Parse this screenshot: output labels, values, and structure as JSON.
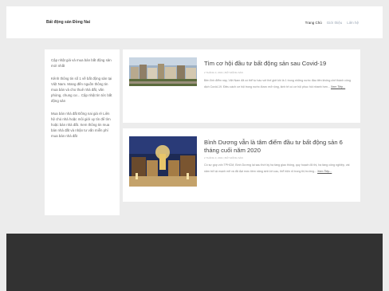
{
  "header": {
    "site_title": "Bất động sản Đồng Nai",
    "nav": [
      "Trang Chủ",
      "Giới thiệu",
      "Liên hệ"
    ]
  },
  "sidebar": {
    "paragraphs": [
      "Cập nhật giá và mua bán bất động sản mới nhất",
      "Kênh thông tin số 1 về bất động sản tại Việt Nam. Mang đến nguồn thông tin mua bán và cho thuê nhà đất, văn phòng, chung cư... Cập nhật tin tức bất động sản",
      "Mua bán nhà đất Đồng nai giá rẻ Liên hệ chủ nhà hoặc môi giới uy tín để tìm hoặc bán nhà đất. Xem thông tin mua bán nhà đất và nhận tư vấn miễn phí mua bán nhà đất"
    ]
  },
  "posts": [
    {
      "title": "Tìm cơ hội đầu tư bất động sản sau Covid-19",
      "meta": "2 THÁNG 3, 2021  |  BẤT ĐỘNG SẢN",
      "excerpt": "Bên lĩnh điểm này, Việt Nam đã có thể tự hào với thế giới khi là 1 trong những nước đầu tiên khống chế thành công dịch Covid-19. Điều cách cơ hội trong nước được mở rộng, kinh tế có cơ hội phục hồi nhanh hơn...",
      "readmore": "Xem Tiếp..."
    },
    {
      "title": "Bình Dương vẫn là tâm điểm đầu tư bất động sản 6 tháng cuối năm 2020",
      "meta": "2 THÁNG 3, 2021  |  BẤT ĐỘNG SẢN",
      "excerpt": "Có sự góp vốn TPHCM, Bình Dương lại sau thời kỳ hạ tầng giao thông, quy hoạch đô thị, hạ tầng công nghiệp, vài năm trở lại mạnh mẽ và đã đạt mức tiềm năng sinh lời cao, thể hiện rõ trong thị trường...",
      "readmore": "Xem Tiếp..."
    }
  ]
}
